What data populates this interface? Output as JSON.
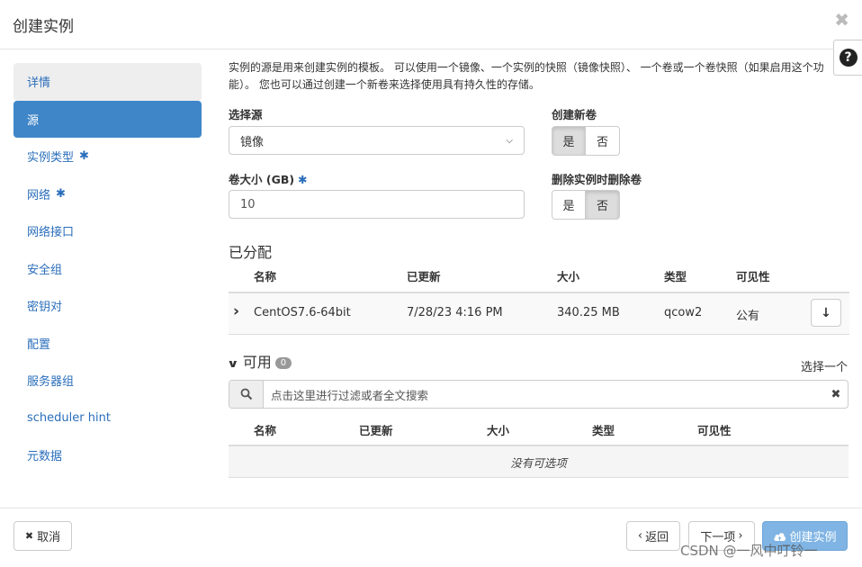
{
  "modal": {
    "title": "创建实例",
    "close": "✖",
    "help": "?"
  },
  "sidebar": {
    "items": [
      {
        "label": "详情",
        "required": false
      },
      {
        "label": "源",
        "required": false
      },
      {
        "label": "实例类型",
        "required": true
      },
      {
        "label": "网络",
        "required": true
      },
      {
        "label": "网络接口",
        "required": false
      },
      {
        "label": "安全组",
        "required": false
      },
      {
        "label": "密钥对",
        "required": false
      },
      {
        "label": "配置",
        "required": false
      },
      {
        "label": "服务器组",
        "required": false
      },
      {
        "label": "scheduler hint",
        "required": false
      },
      {
        "label": "元数据",
        "required": false
      }
    ],
    "required_mark": "✱"
  },
  "main": {
    "intro": "实例的源是用来创建实例的模板。 可以使用一个镜像、一个实例的快照（镜像快照）、 一个卷或一个卷快照（如果启用这个功能）。 您也可以通过创建一个新卷来选择使用具有持久性的存储。",
    "select_source_label": "选择源",
    "select_source_value": "镜像",
    "volume_size_label": "卷大小 (GB)",
    "volume_size_value": "10",
    "create_volume_label": "创建新卷",
    "delete_volume_label": "删除实例时删除卷",
    "yes": "是",
    "no": "否",
    "create_volume_selected": "是",
    "delete_volume_selected": "否",
    "required_mark": "✱"
  },
  "allocated": {
    "title": "已分配",
    "headers": [
      "名称",
      "已更新",
      "大小",
      "类型",
      "可见性"
    ],
    "rows": [
      {
        "name": "CentOS7.6-64bit",
        "updated": "7/28/23 4:16 PM",
        "size": "340.25 MB",
        "type": "qcow2",
        "visibility": "公有"
      }
    ],
    "expand_icon": "›",
    "move_down_icon": "↓"
  },
  "available": {
    "title": "可用",
    "count": "0",
    "select_one": "选择一个",
    "search_placeholder": "点击这里进行过滤或者全文搜索",
    "headers": [
      "名称",
      "已更新",
      "大小",
      "类型",
      "可见性"
    ],
    "empty_text": "没有可选项"
  },
  "footer": {
    "cancel": "取消",
    "back": "返回",
    "next": "下一项",
    "create": "创建实例"
  },
  "watermark": "CSDN @一风中叮铃一",
  "colors": {
    "accent": "#3f86c8",
    "link": "#2a6ebb",
    "primary_disabled": "#7fb4e4"
  }
}
